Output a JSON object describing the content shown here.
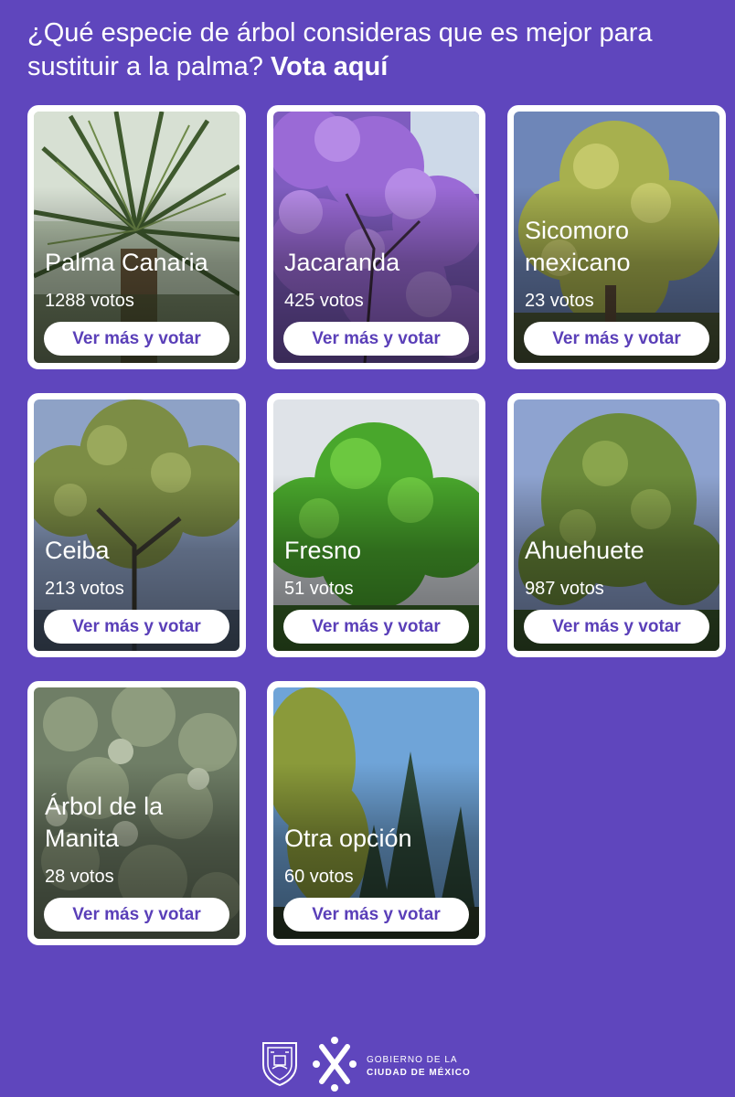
{
  "header": {
    "question": "¿Qué especie de árbol consideras que es mejor para sustituir a la palma?",
    "cta": "Vota aquí"
  },
  "cards": [
    {
      "name": "Palma Canaria",
      "votes": "1288 votos",
      "button": "Ver más y votar"
    },
    {
      "name": "Jacaranda",
      "votes": "425 votos",
      "button": "Ver más y votar"
    },
    {
      "name": "Sicomoro mexicano",
      "votes": "23 votos",
      "button": "Ver más y votar"
    },
    {
      "name": "Ceiba",
      "votes": "213 votos",
      "button": "Ver más y votar"
    },
    {
      "name": "Fresno",
      "votes": "51 votos",
      "button": "Ver más y votar"
    },
    {
      "name": "Ahuehuete",
      "votes": "987 votos",
      "button": "Ver más y votar"
    },
    {
      "name": "Árbol de la Manita",
      "votes": "28 votos",
      "button": "Ver más y votar"
    },
    {
      "name": "Otra opción",
      "votes": "60 votos",
      "button": "Ver más y votar"
    }
  ],
  "footer": {
    "line1": "GOBIERNO DE LA",
    "line2": "CIUDAD DE MÉXICO"
  },
  "colors": {
    "background": "#5f46bd",
    "button_text": "#5a3fb8",
    "card_border": "#ffffff"
  }
}
